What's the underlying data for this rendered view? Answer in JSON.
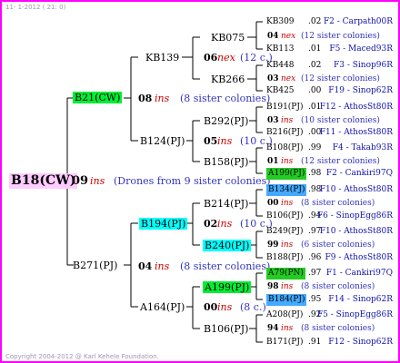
{
  "header": "11- 1-2012 ( 21: 0)",
  "footer": "Copyright 2004-2012 @ Karl Kehele Foundation.",
  "root": {
    "label": "B18(CW)",
    "gen_no": "09",
    "ins": "ins",
    "desc": "(Drones from 9 sister colonies)"
  },
  "gen1": [
    {
      "label": "B21(CW)",
      "gen_no": "08",
      "ins": "ins",
      "desc": "(8 sister colonies)"
    },
    {
      "label": "B271(PJ)",
      "gen_no": "04",
      "ins": "ins",
      "desc": "(8 sister colonies)"
    }
  ],
  "gen2": [
    {
      "label": "KB139",
      "gen_no": "06",
      "ins": "nex",
      "desc": "(12 c.)"
    },
    {
      "label": "B124(PJ)",
      "gen_no": "05",
      "ins": "ins",
      "desc": "(10 c.)"
    },
    {
      "label": "B194(PJ)",
      "gen_no": "02",
      "ins": "ins",
      "desc": "(10 c.)"
    },
    {
      "label": "A164(PJ)",
      "gen_no": "00",
      "ins": "ins",
      "desc": "(8 c.)"
    }
  ],
  "gen3": [
    {
      "label": "KB075"
    },
    {
      "label": "KB266"
    },
    {
      "label": "B292(PJ)"
    },
    {
      "label": "B158(PJ)"
    },
    {
      "label": "B214(PJ)"
    },
    {
      "label": "B240(PJ)"
    },
    {
      "label": "A199(PJ)"
    },
    {
      "label": "B106(PJ)"
    }
  ],
  "gen4": [
    {
      "id": "KB309",
      "year": ".02",
      "src": "F2 - Carpath00R"
    },
    {
      "gen_no": "04",
      "ins": "nex",
      "desc": "(12 sister colonies)"
    },
    {
      "id": "KB113",
      "year": ".01",
      "src": "F5 - Maced93R"
    },
    {
      "id": "KB448",
      "year": ".02",
      "src": "F3 - Sinop96R"
    },
    {
      "gen_no": "03",
      "ins": "nex",
      "desc": "(12 sister colonies)"
    },
    {
      "id": "KB425",
      "year": ".00",
      "src": "F19 - Sinop62R"
    },
    {
      "id": "B191(PJ)",
      "year": ".01",
      "src": "F12 - AthosSt80R"
    },
    {
      "gen_no": "03",
      "ins": "ins",
      "desc": "(10 sister colonies)"
    },
    {
      "id": "B216(PJ)",
      "year": ".00",
      "src": "F11 - AthosSt80R"
    },
    {
      "id": "B108(PJ)",
      "year": ".99",
      "src": "F4 - Takab93R"
    },
    {
      "gen_no": "01",
      "ins": "ins",
      "desc": "(12 sister colonies)"
    },
    {
      "id": "A199(PJ)",
      "year": ".98",
      "src": "F2 - Cankiri97Q"
    },
    {
      "id": "B134(PJ)",
      "year": ".98",
      "src": "F10 - AthosSt80R"
    },
    {
      "gen_no": "00",
      "ins": "ins",
      "desc": "(8 sister colonies)"
    },
    {
      "id": "B106(PJ)",
      "year": ".94",
      "src": "F6 - SinopEgg86R"
    },
    {
      "id": "B249(PJ)",
      "year": ".97",
      "src": "F10 - AthosSt80R"
    },
    {
      "gen_no": "99",
      "ins": "ins",
      "desc": "(6 sister colonies)"
    },
    {
      "id": "B188(PJ)",
      "year": ".96",
      "src": "F9 - AthosSt80R"
    },
    {
      "id": "A79(PN)",
      "year": ".97",
      "src": "F1 - Cankiri97Q"
    },
    {
      "gen_no": "98",
      "ins": "ins",
      "desc": "(8 sister colonies)"
    },
    {
      "id": "B184(PJ)",
      "year": ".95",
      "src": "F14 - Sinop62R"
    },
    {
      "id": "A208(PJ)",
      "year": ".92",
      "src": "F5 - SinopEgg86R"
    },
    {
      "gen_no": "94",
      "ins": "ins",
      "desc": "(8 sister colonies)"
    },
    {
      "id": "B171(PJ)",
      "year": ".91",
      "src": "F12 - Sinop62R"
    }
  ]
}
